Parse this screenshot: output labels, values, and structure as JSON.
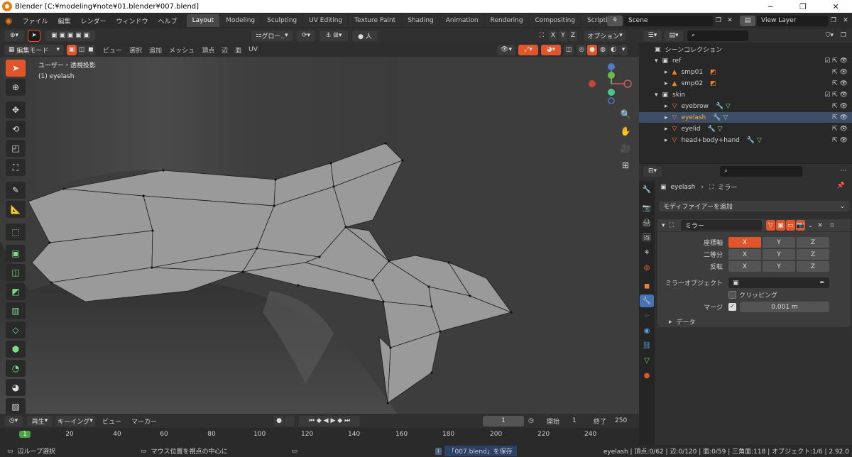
{
  "titlebar": {
    "title": "Blender [C:¥modeling¥note¥01.blender¥007.blend]",
    "minimize": "─",
    "maximize": "❐",
    "close": "✕"
  },
  "menu": [
    "ファイル",
    "編集",
    "レンダー",
    "ウィンドウ",
    "ヘルプ"
  ],
  "workspaces": [
    "Layout",
    "Modeling",
    "Sculpting",
    "UV Editing",
    "Texture Paint",
    "Shading",
    "Animation",
    "Rendering",
    "Compositing",
    "Scripting"
  ],
  "workspace_add": "+",
  "scene": {
    "name": "Scene",
    "view_layer": "View Layer"
  },
  "viewport_header": {
    "transform_orientation": "グロー..",
    "options": "オプション",
    "axes": [
      "X",
      "Y",
      "Z"
    ]
  },
  "edit_header": {
    "mode": "編集モード",
    "menus": [
      "ビュー",
      "選択",
      "追加",
      "メッシュ",
      "頂点",
      "辺",
      "面",
      "UV"
    ]
  },
  "viewport": {
    "view_name": "ユーザー・透視投影",
    "object_name": "(1) eyelash"
  },
  "gizmo": {
    "z": "Z",
    "y": "Y",
    "x": "X"
  },
  "timeline": {
    "playback": "再生",
    "keying": "キーイング",
    "view": "ビュー",
    "marker": "マーカー",
    "current_frame": "1",
    "start_label": "開始",
    "start": "1",
    "end_label": "終了",
    "end": "250",
    "ticks": [
      "1",
      "20",
      "40",
      "60",
      "80",
      "100",
      "120",
      "140",
      "160",
      "180",
      "200",
      "220",
      "240"
    ]
  },
  "status": {
    "left1": "辺ループ選択",
    "left2": "マウス位置を視点の中心に",
    "notice": "「007.blend」を保存",
    "stats": "eyelash | 頂点:0/62 | 辺:0/120 | 面:0/59 | 三角面:118 | オブジェクト:1/6 | 2.92.0"
  },
  "outliner": {
    "title": "シーンコレクション",
    "rows": [
      {
        "name": "ref",
        "level": 1
      },
      {
        "name": "smp01",
        "level": 2
      },
      {
        "name": "smp02",
        "level": 2
      },
      {
        "name": "skin",
        "level": 1
      },
      {
        "name": "eyebrow",
        "level": 2
      },
      {
        "name": "eyelash",
        "level": 2,
        "active": true
      },
      {
        "name": "eyelid",
        "level": 2
      },
      {
        "name": "head+body+hand",
        "level": 2
      }
    ]
  },
  "properties": {
    "breadcrumb_object": "eyelash",
    "breadcrumb_modifier": "ミラー",
    "add_modifier": "モディファイアーを追加",
    "modifier_name": "ミラー",
    "axis_label": "座標軸",
    "bisect_label": "二等分",
    "flip_label": "反転",
    "xyz": [
      "X",
      "Y",
      "Z"
    ],
    "mirror_object_label": "ミラーオブジェクト",
    "clipping_label": "クリッピング",
    "merge_label": "マージ",
    "merge_value": "0.001 m",
    "data_label": "データ"
  },
  "colors": {
    "accent": "#e0562a",
    "active_text": "#ffaf29",
    "bg": "#3d3d3d"
  }
}
